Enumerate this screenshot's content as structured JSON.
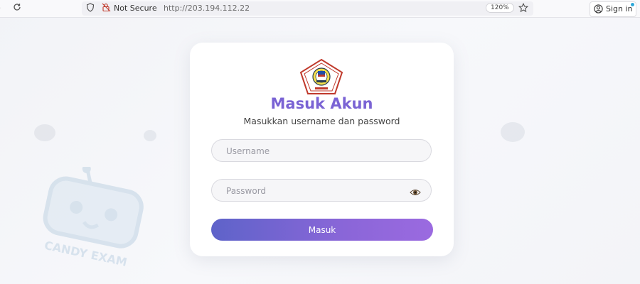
{
  "browser": {
    "security_label": "Not Secure",
    "url": "http://203.194.112.22",
    "zoom": "120%",
    "signin_label": "Sign in",
    "icons": [
      "back-icon",
      "reload-icon",
      "shield-icon",
      "not-secure-lock-icon",
      "bookmark-star-icon",
      "account-icon"
    ]
  },
  "login": {
    "title": "Masuk Akun",
    "subtitle": "Masukkan username dan password",
    "username_placeholder": "Username",
    "password_placeholder": "Password",
    "submit_label": "Masuk"
  },
  "background": {
    "watermark_text": "CANDY EXAM"
  },
  "colors": {
    "title": "#7a63d4",
    "button_start": "#5e63c9",
    "button_end": "#9b6ae0",
    "card": "#ffffff"
  }
}
